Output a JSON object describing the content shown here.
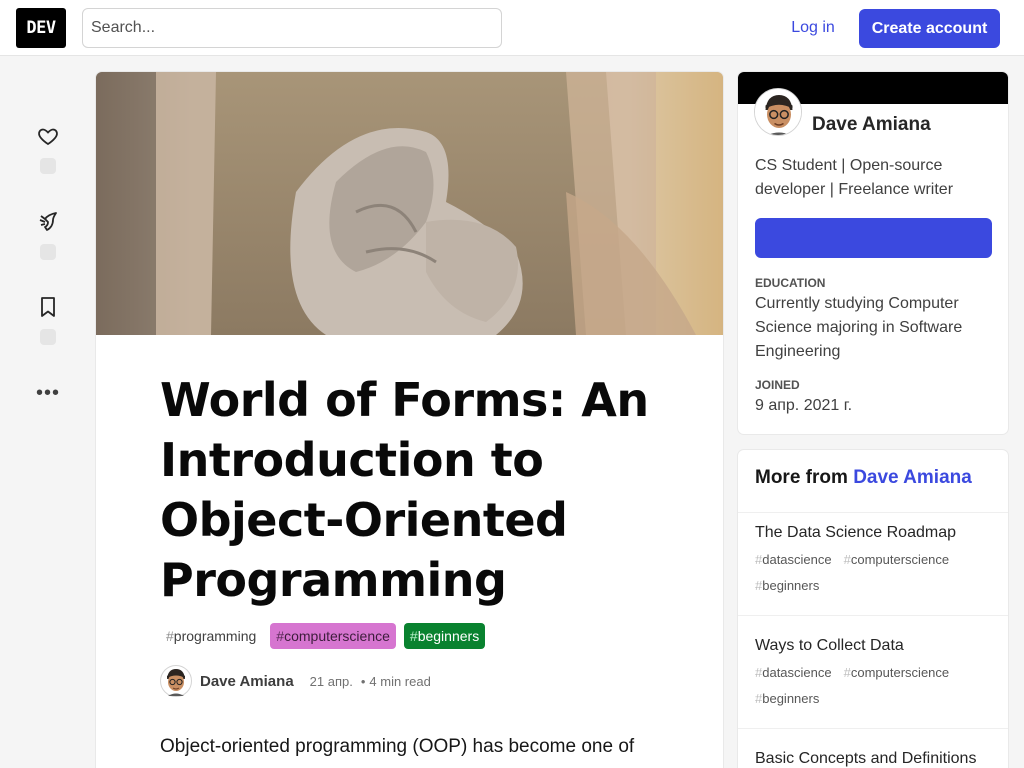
{
  "header": {
    "logo_text": "DEV",
    "search_placeholder": "Search...",
    "login_label": "Log in",
    "create_account_label": "Create account"
  },
  "reactions": {
    "icons": [
      "heart-icon",
      "unicorn-icon",
      "bookmark-icon"
    ],
    "more_label": "•••"
  },
  "article": {
    "title": "World of Forms: An Introduction to Object-Oriented Programming",
    "tags": [
      {
        "hash": "#",
        "name": "programming"
      },
      {
        "hash": "#",
        "name": "computerscience"
      },
      {
        "hash": "#",
        "name": "beginners"
      }
    ],
    "tag_colors": [
      "#ffffff",
      "#d675d0",
      "#09822f"
    ],
    "author": "Dave Amiana",
    "date": "21 апр.",
    "dot": "•",
    "read_time": "4 min read",
    "body_start": "Object-oriented programming (OOP) has become one of the most popular programming paradigms in the"
  },
  "profile": {
    "name": "Dave Amiana",
    "bio": "CS Student | Open-source developer | Freelance writer",
    "education_label": "EDUCATION",
    "education_value": "Currently studying Computer Science majoring in Software Engineering",
    "joined_label": "JOINED",
    "joined_value": "9 апр. 2021 г."
  },
  "more_from": {
    "prefix": "More from",
    "author": "Dave Amiana",
    "items": [
      {
        "title": "The Data Science Roadmap",
        "tags": [
          "datascience",
          "computerscience",
          "beginners"
        ]
      },
      {
        "title": "Ways to Collect Data",
        "tags": [
          "datascience",
          "computerscience",
          "beginners"
        ]
      },
      {
        "title": "Basic Concepts and Definitions in",
        "tags": []
      }
    ],
    "hash": "#"
  },
  "colors": {
    "accent": "#3b49df",
    "background": "#f5f5f5",
    "logo_bg": "#000000"
  }
}
